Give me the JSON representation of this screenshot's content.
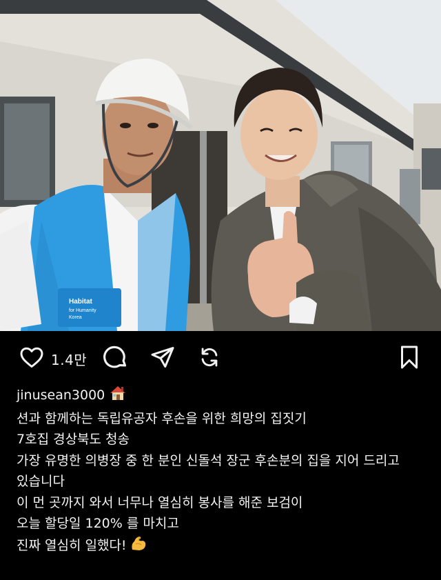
{
  "post": {
    "like_count": "1.4만",
    "username": "jinusean3000",
    "username_emoji": "house-emoji",
    "caption_lines": [
      "션과 함께하는 독립유공자 후손을 위한 희망의 집짓기",
      "7호집 경상북도 청송",
      "가장 유명한 의병장 중 한 분인 신돌석 장군 후손분의 집을 지어 드리고",
      "있습니다",
      "이 먼 곳까지 와서 너무나 열심히 봉사를 해준 보검이",
      "오늘 할당일 120% 를 마치고",
      "진짜 열심히 일했다!"
    ],
    "final_emoji": "flexed-biceps-emoji",
    "vest_logo_text": [
      "Habitat",
      "for Humanity",
      "Korea"
    ]
  },
  "icons": {
    "like": "heart-icon",
    "comment": "comment-icon",
    "share": "send-icon",
    "repost": "repost-icon",
    "save": "bookmark-icon"
  },
  "colors": {
    "background": "#000000",
    "text": "#f2f2f2",
    "vest_blue": "#2f9be0"
  }
}
